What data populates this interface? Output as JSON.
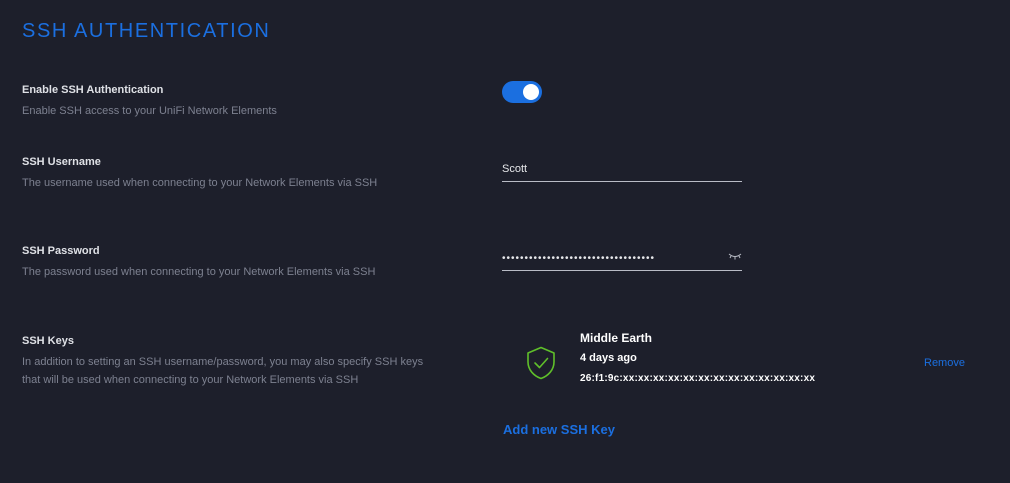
{
  "page": {
    "title": "SSH AUTHENTICATION"
  },
  "colors": {
    "background": "#1d1f2b",
    "accent": "#1b6fe0",
    "shield": "#5fbf2a"
  },
  "enable_ssh": {
    "title": "Enable SSH Authentication",
    "description": "Enable SSH access to your UniFi Network Elements",
    "enabled": true
  },
  "username": {
    "title": "SSH Username",
    "description": "The username used when connecting to your Network Elements via SSH",
    "value": "Scott"
  },
  "password": {
    "title": "SSH Password",
    "description": "The password used when connecting to your Network Elements via SSH",
    "value": "••••••••••••••••••••••••••••••••••"
  },
  "ssh_keys": {
    "title": "SSH Keys",
    "description": "In addition to setting an SSH username/password, you may also specify SSH keys that will be used when connecting to your Network Elements via SSH",
    "keys": [
      {
        "icon": "shield-check-icon",
        "name": "Middle Earth",
        "age": "4 days ago",
        "fingerprint": "26:f1:9c:xx:xx:xx:xx:xx:xx:xx:xx:xx:xx:xx:xx:xx",
        "remove_label": "Remove"
      }
    ],
    "add_label": "Add new SSH Key"
  }
}
